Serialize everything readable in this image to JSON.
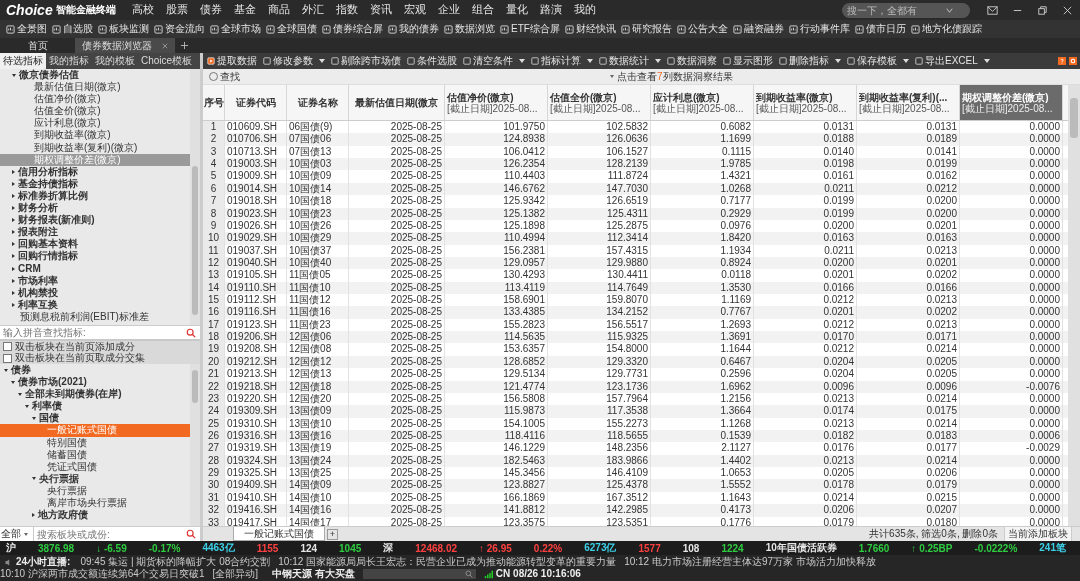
{
  "app": {
    "logo": "Choice",
    "subtitle": "智能金融终端",
    "search_placeholder": "搜一下，全都有"
  },
  "menu": [
    "高校",
    "股票",
    "债券",
    "基金",
    "商品",
    "外汇",
    "指数",
    "资讯",
    "宏观",
    "企业",
    "组合",
    "量化",
    "路演",
    "我的"
  ],
  "shortcuts": [
    "全景图",
    "自选股",
    "板块监测",
    "资金流向",
    "全球市场",
    "全球国债",
    "债券综合屏",
    "我的债券",
    "数据浏览",
    "ETF综合屏",
    "财经快讯",
    "研究报告",
    "公告大全",
    "融资融券",
    "行动事件库",
    "债市日历",
    "地方化债跟踪"
  ],
  "doc_tabs": [
    {
      "label": "首页",
      "selected": false,
      "closable": false
    },
    {
      "label": "债券数据浏览器",
      "selected": true,
      "closable": true
    }
  ],
  "panel_tabs": [
    {
      "label": "待选指标",
      "selected": true
    },
    {
      "label": "我的指标",
      "selected": false
    },
    {
      "label": "我的模板",
      "selected": false
    },
    {
      "label": "Choice模板",
      "selected": false
    }
  ],
  "actions": [
    {
      "label": "提取数据",
      "dropdown": false,
      "kind": "primary"
    },
    {
      "label": "修改参数",
      "dropdown": true,
      "kind": "normal"
    },
    {
      "label": "剔除跨市场债",
      "dropdown": false,
      "kind": "normal"
    },
    {
      "label": "条件选股",
      "dropdown": false,
      "kind": "normal"
    },
    {
      "label": "清空条件",
      "dropdown": true,
      "kind": "normal"
    },
    {
      "label": "指标计算",
      "dropdown": true,
      "kind": "normal"
    },
    {
      "label": "数据统计",
      "dropdown": true,
      "kind": "normal"
    },
    {
      "label": "数据洞察",
      "dropdown": false,
      "kind": "normal"
    },
    {
      "label": "显示图形",
      "dropdown": false,
      "kind": "normal"
    },
    {
      "label": "删除指标",
      "dropdown": true,
      "kind": "normal"
    },
    {
      "label": "保存模板",
      "dropdown": true,
      "kind": "normal"
    },
    {
      "label": "导出EXCEL",
      "dropdown": true,
      "kind": "normal"
    }
  ],
  "indicator_tree": [
    {
      "label": "微京债券估值",
      "expanded": true,
      "selected": false,
      "children": [
        {
          "label": "最新估值日期(微京)",
          "selected": false
        },
        {
          "label": "估值净价(微京)",
          "selected": false
        },
        {
          "label": "估值全价(微京)",
          "selected": false
        },
        {
          "label": "应计利息(微京)",
          "selected": false
        },
        {
          "label": "到期收益率(微京)",
          "selected": false
        },
        {
          "label": "到期收益率(复利)(微京)",
          "selected": false
        },
        {
          "label": "期权调整价差(微京)",
          "selected": true
        }
      ]
    },
    {
      "label": "信用分析指标",
      "expanded": false,
      "selected": false
    },
    {
      "label": "基金持债指标",
      "expanded": false,
      "selected": false
    },
    {
      "label": "标准券折算比例",
      "expanded": false,
      "selected": false
    },
    {
      "label": "财务分析",
      "expanded": false,
      "selected": false
    },
    {
      "label": "财务报表(新准则)",
      "expanded": false,
      "selected": false
    },
    {
      "label": "报表附注",
      "expanded": false,
      "selected": false
    },
    {
      "label": "回购基本资料",
      "expanded": false,
      "selected": false
    },
    {
      "label": "回购行情指标",
      "expanded": false,
      "selected": false
    },
    {
      "label": "CRM",
      "expanded": false,
      "selected": false
    },
    {
      "label": "市场利率",
      "expanded": false,
      "selected": false
    },
    {
      "label": "机构禁投",
      "expanded": false,
      "selected": false
    },
    {
      "label": "利率互换",
      "expanded": false,
      "selected": false
    },
    {
      "label": "预测息税前利润(EBIT)标准差",
      "selected": false
    }
  ],
  "indicator_search": {
    "placeholder": "输入拼音查找指标:"
  },
  "options": [
    {
      "label": "双击板块在当前页添加成分",
      "checked": false
    },
    {
      "label": "双击板块在当前页取成分交集",
      "checked": false
    }
  ],
  "sector_tree": [
    {
      "label": "债券",
      "expanded": true,
      "selected": false,
      "children": [
        {
          "label": "债券市场(2021)",
          "expanded": true,
          "selected": false,
          "children": [
            {
              "label": "全部未到期债券(在岸)",
              "expanded": true,
              "selected": false,
              "children": [
                {
                  "label": "利率债",
                  "expanded": true,
                  "selected": false,
                  "children": [
                    {
                      "label": "国债",
                      "expanded": true,
                      "selected": false,
                      "children": [
                        {
                          "label": "一般记账式国债",
                          "selected": true
                        },
                        {
                          "label": "特别国债",
                          "selected": false
                        },
                        {
                          "label": "储蓄国债",
                          "selected": false
                        },
                        {
                          "label": "凭证式国债",
                          "selected": false
                        }
                      ]
                    },
                    {
                      "label": "央行票据",
                      "expanded": true,
                      "selected": false,
                      "children": [
                        {
                          "label": "央行票据",
                          "selected": false
                        },
                        {
                          "label": "离岸市场央行票据",
                          "selected": false
                        }
                      ]
                    },
                    {
                      "label": "地方政府债",
                      "expanded": false,
                      "selected": false
                    }
                  ]
                }
              ]
            }
          ]
        }
      ]
    }
  ],
  "sector_search": {
    "scope": "全部",
    "placeholder": "搜索板块或成份:"
  },
  "find": {
    "label": "查找"
  },
  "insight": {
    "prefix": "点击查看",
    "count": "7",
    "suffix": "列数据洞察结果"
  },
  "table": {
    "columns": [
      {
        "title": "序号",
        "selected": false
      },
      {
        "title": "证券代码",
        "selected": false
      },
      {
        "title": "证券名称",
        "selected": false
      },
      {
        "title": "最新估值日期(微京",
        "selected": false
      },
      {
        "title": "估值净价(微京)",
        "subtitle": "[截止日期]2025-08...",
        "selected": false
      },
      {
        "title": "估值全价(微京)",
        "subtitle": "[截止日期]2025-08...",
        "selected": false
      },
      {
        "title": "应计利息(微京)",
        "subtitle": "[截止日期]2025-08...",
        "selected": false
      },
      {
        "title": "到期收益率(微京)",
        "subtitle": "[截止日期]2025-08...",
        "selected": false
      },
      {
        "title": "到期收益率(复利)(...",
        "subtitle": "[截止日期]2025-08...",
        "selected": false
      },
      {
        "title": "期权调整价差(微京)",
        "subtitle": "[截止日期]2025-08...",
        "selected": true
      }
    ],
    "rows": [
      [
        "1",
        "010609.SH",
        "06国债(9)",
        "2025-08-25",
        "101.9750",
        "102.5832",
        "0.6082",
        "0.0131",
        "0.0131",
        "0.0000"
      ],
      [
        "2",
        "010706.SH",
        "07国债06",
        "2025-08-25",
        "124.8938",
        "126.0636",
        "1.1699",
        "0.0188",
        "0.0189",
        "0.0000"
      ],
      [
        "3",
        "010713.SH",
        "07国债13",
        "2025-08-25",
        "106.0412",
        "106.1527",
        "0.1115",
        "0.0140",
        "0.0141",
        "0.0000"
      ],
      [
        "4",
        "019003.SH",
        "10国债03",
        "2025-08-25",
        "126.2354",
        "128.2139",
        "1.9785",
        "0.0198",
        "0.0199",
        "0.0000"
      ],
      [
        "5",
        "019009.SH",
        "10国债09",
        "2025-08-25",
        "110.4403",
        "111.8724",
        "1.4321",
        "0.0161",
        "0.0162",
        "0.0000"
      ],
      [
        "6",
        "019014.SH",
        "10国债14",
        "2025-08-25",
        "146.6762",
        "147.7030",
        "1.0268",
        "0.0211",
        "0.0212",
        "0.0000"
      ],
      [
        "7",
        "019018.SH",
        "10国债18",
        "2025-08-25",
        "125.9342",
        "126.6519",
        "0.7177",
        "0.0199",
        "0.0200",
        "0.0000"
      ],
      [
        "8",
        "019023.SH",
        "10国债23",
        "2025-08-25",
        "125.1382",
        "125.4311",
        "0.2929",
        "0.0199",
        "0.0200",
        "0.0000"
      ],
      [
        "9",
        "019026.SH",
        "10国债26",
        "2025-08-25",
        "125.1898",
        "125.2875",
        "0.0976",
        "0.0200",
        "0.0201",
        "0.0000"
      ],
      [
        "10",
        "019029.SH",
        "10国债29",
        "2025-08-25",
        "110.4994",
        "112.3414",
        "1.8420",
        "0.0163",
        "0.0163",
        "0.0000"
      ],
      [
        "11",
        "019037.SH",
        "10国债37",
        "2025-08-25",
        "156.2381",
        "157.4315",
        "1.1934",
        "0.0211",
        "0.0213",
        "0.0000"
      ],
      [
        "12",
        "019040.SH",
        "10国债40",
        "2025-08-25",
        "129.0957",
        "129.9880",
        "0.8924",
        "0.0200",
        "0.0201",
        "0.0000"
      ],
      [
        "13",
        "019105.SH",
        "11国债05",
        "2025-08-25",
        "130.4293",
        "130.4411",
        "0.0118",
        "0.0201",
        "0.0202",
        "0.0000"
      ],
      [
        "14",
        "019110.SH",
        "11国债10",
        "2025-08-25",
        "113.4119",
        "114.7649",
        "1.3530",
        "0.0166",
        "0.0166",
        "0.0000"
      ],
      [
        "15",
        "019112.SH",
        "11国债12",
        "2025-08-25",
        "158.6901",
        "159.8070",
        "1.1169",
        "0.0212",
        "0.0213",
        "0.0000"
      ],
      [
        "16",
        "019116.SH",
        "11国债16",
        "2025-08-25",
        "133.4385",
        "134.2152",
        "0.7767",
        "0.0201",
        "0.0202",
        "0.0000"
      ],
      [
        "17",
        "019123.SH",
        "11国债23",
        "2025-08-25",
        "155.2823",
        "156.5517",
        "1.2693",
        "0.0212",
        "0.0213",
        "0.0000"
      ],
      [
        "18",
        "019206.SH",
        "12国债06",
        "2025-08-25",
        "114.5635",
        "115.9325",
        "1.3691",
        "0.0170",
        "0.0171",
        "0.0000"
      ],
      [
        "19",
        "019208.SH",
        "12国债08",
        "2025-08-25",
        "153.6357",
        "154.8000",
        "1.1644",
        "0.0212",
        "0.0214",
        "0.0000"
      ],
      [
        "20",
        "019212.SH",
        "12国债12",
        "2025-08-25",
        "128.6852",
        "129.3320",
        "0.6467",
        "0.0204",
        "0.0205",
        "0.0000"
      ],
      [
        "21",
        "019213.SH",
        "12国债13",
        "2025-08-25",
        "129.5134",
        "129.7731",
        "0.2596",
        "0.0204",
        "0.0205",
        "0.0000"
      ],
      [
        "22",
        "019218.SH",
        "12国债18",
        "2025-08-25",
        "121.4774",
        "123.1736",
        "1.6962",
        "0.0096",
        "0.0096",
        "-0.0076"
      ],
      [
        "23",
        "019220.SH",
        "12国债20",
        "2025-08-25",
        "156.5808",
        "157.7964",
        "1.2156",
        "0.0213",
        "0.0214",
        "0.0000"
      ],
      [
        "24",
        "019309.SH",
        "13国债09",
        "2025-08-25",
        "115.9873",
        "117.3538",
        "1.3664",
        "0.0174",
        "0.0175",
        "0.0000"
      ],
      [
        "25",
        "019310.SH",
        "13国债10",
        "2025-08-25",
        "154.1005",
        "155.2273",
        "1.1268",
        "0.0213",
        "0.0214",
        "0.0000"
      ],
      [
        "26",
        "019316.SH",
        "13国债16",
        "2025-08-25",
        "118.4116",
        "118.5655",
        "0.1539",
        "0.0182",
        "0.0183",
        "0.0006"
      ],
      [
        "27",
        "019319.SH",
        "13国债19",
        "2025-08-25",
        "146.1229",
        "148.2356",
        "2.1127",
        "0.0176",
        "0.0177",
        "-0.0029"
      ],
      [
        "28",
        "019324.SH",
        "13国债24",
        "2025-08-25",
        "182.5463",
        "183.9866",
        "1.4402",
        "0.0213",
        "0.0214",
        "0.0000"
      ],
      [
        "29",
        "019325.SH",
        "13国债25",
        "2025-08-25",
        "145.3456",
        "146.4109",
        "1.0653",
        "0.0205",
        "0.0206",
        "0.0000"
      ],
      [
        "30",
        "019409.SH",
        "14国债09",
        "2025-08-25",
        "123.8827",
        "125.4378",
        "1.5552",
        "0.0178",
        "0.0179",
        "0.0000"
      ],
      [
        "31",
        "019410.SH",
        "14国债10",
        "2025-08-25",
        "166.1869",
        "167.3512",
        "1.1643",
        "0.0214",
        "0.0215",
        "0.0000"
      ],
      [
        "32",
        "019416.SH",
        "14国债16",
        "2025-08-25",
        "141.8812",
        "142.2985",
        "0.4173",
        "0.0206",
        "0.0207",
        "0.0000"
      ],
      [
        "33",
        "019417.SH",
        "14国债17",
        "2025-08-25",
        "123.3575",
        "123.5351",
        "0.1776",
        "0.0179",
        "0.0180",
        "0.0000"
      ]
    ]
  },
  "sheet_tabs": [
    {
      "label": "一般记账式国债",
      "selected": true
    }
  ],
  "sheet_add": "+",
  "sheet_status": "共计635条, 筛选0条, 删除0条",
  "sheet_action": "当前添加板块",
  "market": [
    {
      "text": "沪",
      "color": "#e6e6e6"
    },
    {
      "text": "3876.98",
      "color": "#2ecc40"
    },
    {
      "text": "↓ -6.59",
      "color": "#2ecc40"
    },
    {
      "text": "-0.17%",
      "color": "#2ecc40"
    },
    {
      "text": "4463亿",
      "color": "#3cd0e8"
    },
    {
      "text": "1155",
      "color": "#ff4040"
    },
    {
      "text": "124",
      "color": "#e6e6e6"
    },
    {
      "text": "1045",
      "color": "#2ecc40"
    },
    {
      "text": "深",
      "color": "#e6e6e6"
    },
    {
      "text": "12468.02",
      "color": "#ff4040"
    },
    {
      "text": "↑ 26.95",
      "color": "#ff4040"
    },
    {
      "text": "0.22%",
      "color": "#ff4040"
    },
    {
      "text": "6273亿",
      "color": "#3cd0e8"
    },
    {
      "text": "1577",
      "color": "#ff4040"
    },
    {
      "text": "108",
      "color": "#e6e6e6"
    },
    {
      "text": "1224",
      "color": "#2ecc40"
    },
    {
      "text": "10年国债活跃券",
      "color": "#e6e6e6"
    },
    {
      "text": "1.7660",
      "color": "#2ecc40"
    },
    {
      "text": "↑ 0.25BP",
      "color": "#2ecc40"
    },
    {
      "text": "-0.0222%",
      "color": "#2ecc40"
    },
    {
      "text": "241笔",
      "color": "#3cd0e8"
    }
  ],
  "news": {
    "label": "24小时直播:",
    "items": [
      "09:45 集运 | 期货标的降幅扩大 08合约交割",
      "10:12 国家能源局局长王宏志：民营企业已成为推动能源转型变革的重要力量",
      "10:12 电力市场注册经营主体达97万家 市场活力加快释放",
      "10:10 沪深两市成交额连续第64个交易日突破1"
    ],
    "more": "[全部异动]",
    "alert": "中钢天源 有大买盘",
    "clock": "CN 08/26 10:16:06"
  }
}
